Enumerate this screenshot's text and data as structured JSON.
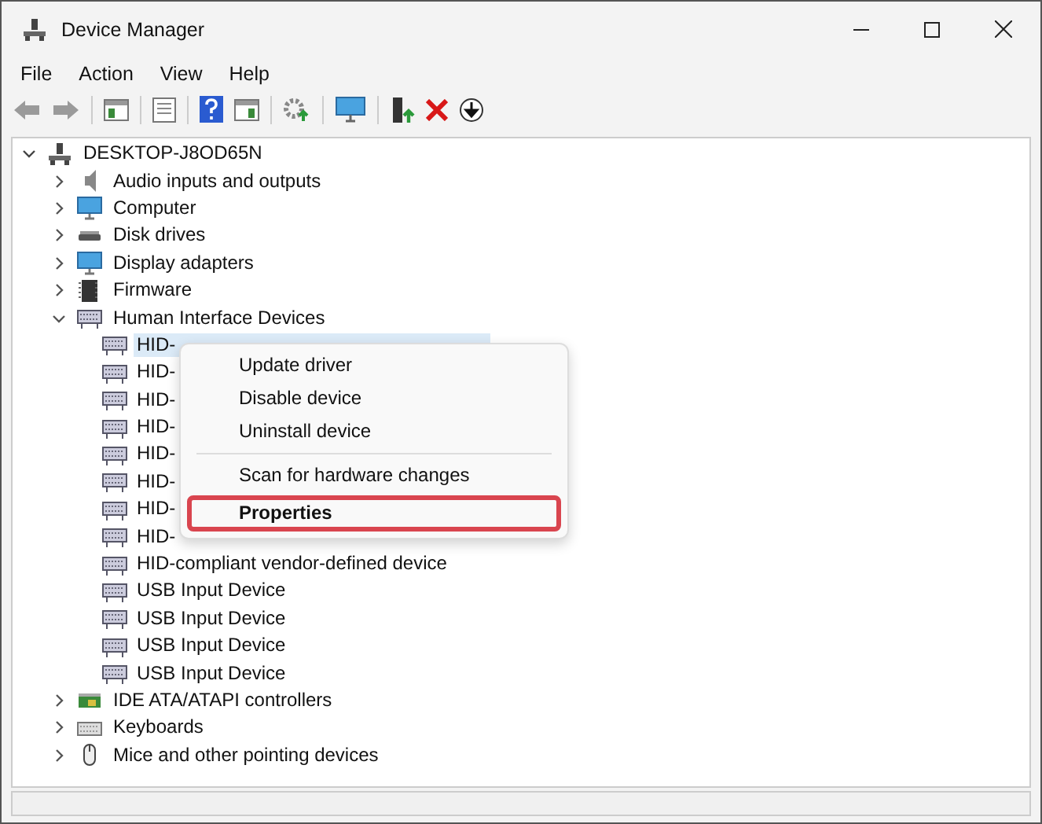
{
  "window": {
    "title": "Device Manager"
  },
  "menu_bar": [
    "File",
    "Action",
    "View",
    "Help"
  ],
  "tree": {
    "label": "DESKTOP-J8OD65N",
    "expanded": true,
    "children": [
      {
        "label": "Audio inputs and outputs",
        "expanded": false
      },
      {
        "label": "Computer",
        "expanded": false
      },
      {
        "label": "Disk drives",
        "expanded": false
      },
      {
        "label": "Display adapters",
        "expanded": false
      },
      {
        "label": "Firmware",
        "expanded": false
      },
      {
        "label": "Human Interface Devices",
        "expanded": true,
        "children": [
          {
            "label": "HID-",
            "selected": true
          },
          {
            "label": "HID-",
            "selected": false
          },
          {
            "label": "HID-",
            "selected": false
          },
          {
            "label": "HID-",
            "selected": false
          },
          {
            "label": "HID-",
            "selected": false
          },
          {
            "label": "HID-",
            "selected": false
          },
          {
            "label": "HID-",
            "selected": false
          },
          {
            "label": "HID-",
            "selected": false
          },
          {
            "label": "HID-compliant vendor-defined device",
            "selected": false
          },
          {
            "label": "USB Input Device",
            "selected": false
          },
          {
            "label": "USB Input Device",
            "selected": false
          },
          {
            "label": "USB Input Device",
            "selected": false
          },
          {
            "label": "USB Input Device",
            "selected": false
          }
        ]
      },
      {
        "label": "IDE ATA/ATAPI controllers",
        "expanded": false
      },
      {
        "label": "Keyboards",
        "expanded": false
      },
      {
        "label": "Mice and other pointing devices",
        "expanded": false
      }
    ]
  },
  "context_menu": [
    {
      "kind": "item",
      "label": "Update driver",
      "bold": false,
      "highlighted": false
    },
    {
      "kind": "item",
      "label": "Disable device",
      "bold": false,
      "highlighted": false
    },
    {
      "kind": "item",
      "label": "Uninstall device",
      "bold": false,
      "highlighted": false
    },
    {
      "kind": "separator"
    },
    {
      "kind": "item",
      "label": "Scan for hardware changes",
      "bold": false,
      "highlighted": false
    },
    {
      "kind": "item",
      "label": "Properties",
      "bold": true,
      "highlighted": true
    }
  ]
}
